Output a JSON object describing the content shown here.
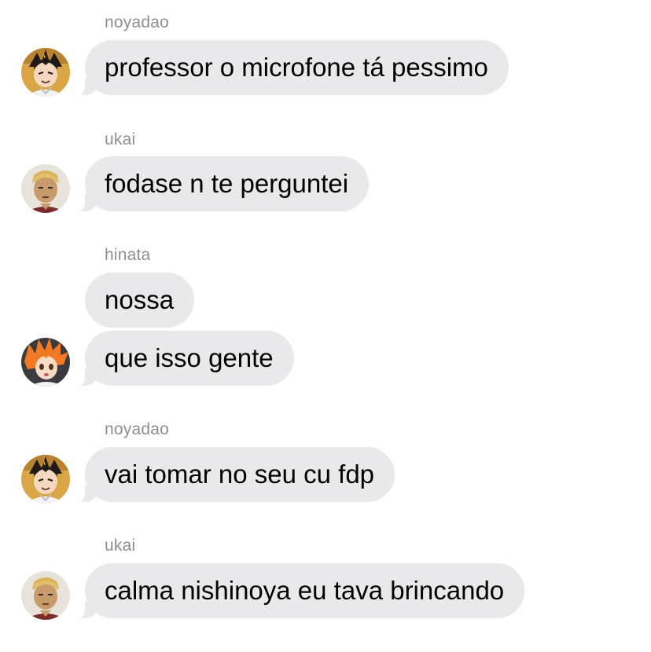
{
  "colors": {
    "incoming_bubble": "#e9e9eb",
    "sender_name": "#8e8e93",
    "message_text": "#000000",
    "background": "#ffffff"
  },
  "messages": [
    {
      "sender": "noyadao",
      "avatar": "noya-avatar-icon",
      "texts": [
        "professor o microfone tá pessimo"
      ]
    },
    {
      "sender": "ukai",
      "avatar": "ukai-avatar-icon",
      "texts": [
        "fodase n te perguntei"
      ]
    },
    {
      "sender": "hinata",
      "avatar": "hinata-avatar-icon",
      "texts": [
        "nossa",
        "que isso gente"
      ]
    },
    {
      "sender": "noyadao",
      "avatar": "noya-avatar-icon",
      "texts": [
        "vai tomar no seu cu fdp"
      ]
    },
    {
      "sender": "ukai",
      "avatar": "ukai-avatar-icon",
      "texts": [
        "calma nishinoya eu tava brincando"
      ]
    }
  ]
}
